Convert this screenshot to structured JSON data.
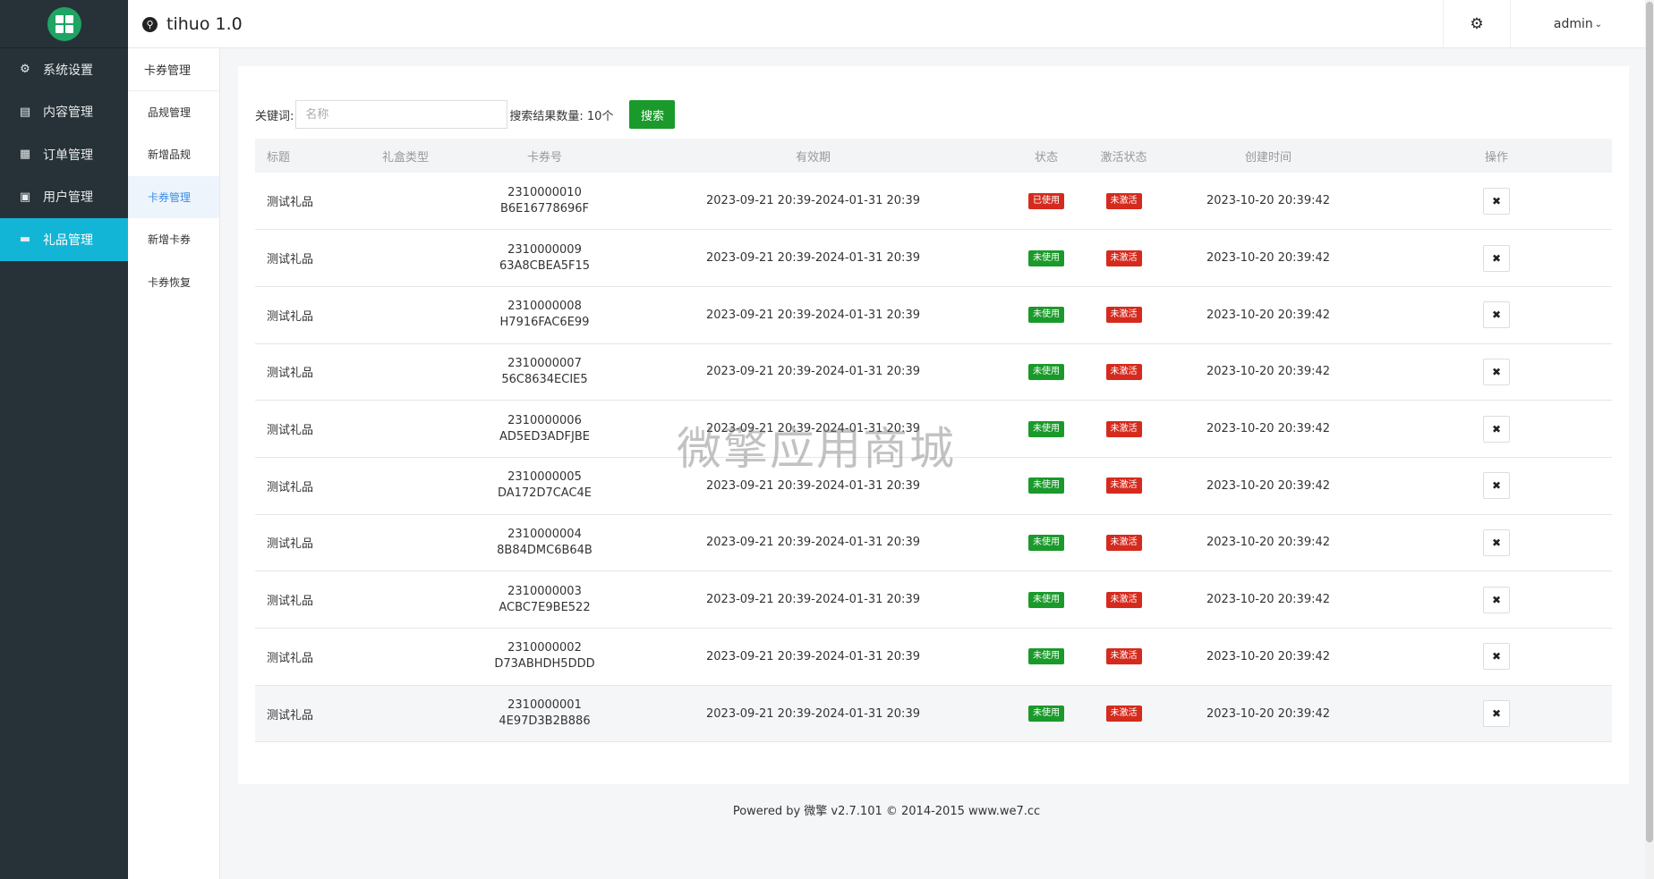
{
  "app": {
    "title": "tihuo 1.0",
    "user": "admin",
    "user_caret": "⌄"
  },
  "sidebar": {
    "items": [
      {
        "label": "系统设置",
        "icon": "gear-icon",
        "glyph": "⚙"
      },
      {
        "label": "内容管理",
        "icon": "content-icon",
        "glyph": "▤"
      },
      {
        "label": "订单管理",
        "icon": "document-icon",
        "glyph": "▦"
      },
      {
        "label": "用户管理",
        "icon": "user-icon",
        "glyph": "▣"
      },
      {
        "label": "礼品管理",
        "icon": "monitor-icon",
        "glyph": "▬",
        "active": true
      }
    ]
  },
  "subnav": {
    "header": "卡券管理",
    "items": [
      "品规管理",
      "新增品规",
      "卡券管理",
      "新增卡券",
      "卡券恢复"
    ],
    "active_index": 2
  },
  "search": {
    "keyword_label": "关键词:",
    "placeholder": "名称",
    "value": "",
    "result_label": "搜索结果数量: 10个",
    "button_label": "搜索"
  },
  "table": {
    "headers": [
      "标题",
      "礼盒类型",
      "卡券号",
      "有效期",
      "状态",
      "激活状态",
      "创建时间",
      "操作"
    ],
    "rows": [
      {
        "title": "测试礼品",
        "type": "",
        "no": "2310000010",
        "code": "B6E16778696F",
        "validity": "2023-09-21 20:39-2024-01-31 20:39",
        "status": "已使用",
        "status_color": "red",
        "activation": "未激活",
        "created": "2023-10-20 20:39:42"
      },
      {
        "title": "测试礼品",
        "type": "",
        "no": "2310000009",
        "code": "63A8CBEA5F15",
        "validity": "2023-09-21 20:39-2024-01-31 20:39",
        "status": "未使用",
        "status_color": "green",
        "activation": "未激活",
        "created": "2023-10-20 20:39:42"
      },
      {
        "title": "测试礼品",
        "type": "",
        "no": "2310000008",
        "code": "H7916FAC6E99",
        "validity": "2023-09-21 20:39-2024-01-31 20:39",
        "status": "未使用",
        "status_color": "green",
        "activation": "未激活",
        "created": "2023-10-20 20:39:42"
      },
      {
        "title": "测试礼品",
        "type": "",
        "no": "2310000007",
        "code": "56C8634ECIE5",
        "validity": "2023-09-21 20:39-2024-01-31 20:39",
        "status": "未使用",
        "status_color": "green",
        "activation": "未激活",
        "created": "2023-10-20 20:39:42"
      },
      {
        "title": "测试礼品",
        "type": "",
        "no": "2310000006",
        "code": "AD5ED3ADFJBE",
        "validity": "2023-09-21 20:39-2024-01-31 20:39",
        "status": "未使用",
        "status_color": "green",
        "activation": "未激活",
        "created": "2023-10-20 20:39:42"
      },
      {
        "title": "测试礼品",
        "type": "",
        "no": "2310000005",
        "code": "DA172D7CAC4E",
        "validity": "2023-09-21 20:39-2024-01-31 20:39",
        "status": "未使用",
        "status_color": "green",
        "activation": "未激活",
        "created": "2023-10-20 20:39:42"
      },
      {
        "title": "测试礼品",
        "type": "",
        "no": "2310000004",
        "code": "8B84DMC6B64B",
        "validity": "2023-09-21 20:39-2024-01-31 20:39",
        "status": "未使用",
        "status_color": "green",
        "activation": "未激活",
        "created": "2023-10-20 20:39:42"
      },
      {
        "title": "测试礼品",
        "type": "",
        "no": "2310000003",
        "code": "ACBC7E9BE522",
        "validity": "2023-09-21 20:39-2024-01-31 20:39",
        "status": "未使用",
        "status_color": "green",
        "activation": "未激活",
        "created": "2023-10-20 20:39:42"
      },
      {
        "title": "测试礼品",
        "type": "",
        "no": "2310000002",
        "code": "D73ABHDH5DDD",
        "validity": "2023-09-21 20:39-2024-01-31 20:39",
        "status": "未使用",
        "status_color": "green",
        "activation": "未激活",
        "created": "2023-10-20 20:39:42"
      },
      {
        "title": "测试礼品",
        "type": "",
        "no": "2310000001",
        "code": "4E97D3B2B886",
        "validity": "2023-09-21 20:39-2024-01-31 20:39",
        "status": "未使用",
        "status_color": "green",
        "activation": "未激活",
        "created": "2023-10-20 20:39:42",
        "highlighted": true
      }
    ],
    "delete_glyph": "✖"
  },
  "watermark": "微擎应用商城",
  "footer": "Powered by 微擎 v2.7.101 © 2014-2015 www.we7.cc",
  "colors": {
    "sidebar_bg": "#263238",
    "active_accent": "#13b5d6",
    "success": "#1a9a2a",
    "danger": "#d52b1e"
  }
}
